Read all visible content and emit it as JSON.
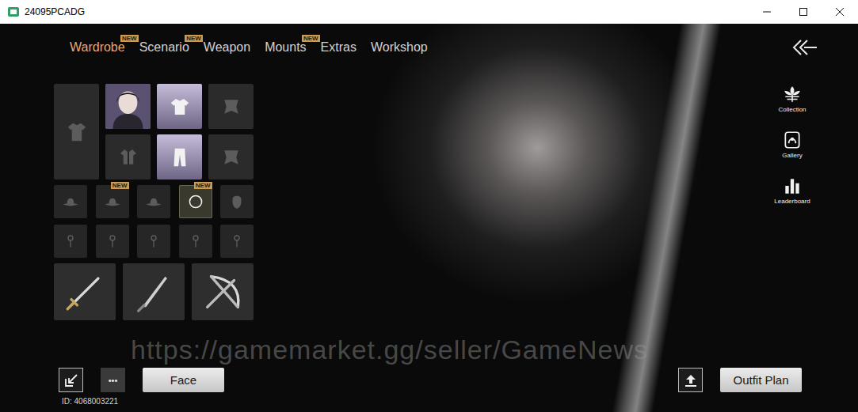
{
  "window": {
    "title": "24095PCADG"
  },
  "tabs": [
    {
      "label": "Wardrobe",
      "selected": true,
      "badge": "NEW"
    },
    {
      "label": "Scenario",
      "selected": false,
      "badge": "NEW"
    },
    {
      "label": "Weapon",
      "selected": false,
      "badge": ""
    },
    {
      "label": "Mounts",
      "selected": false,
      "badge": "NEW"
    },
    {
      "label": "Extras",
      "selected": false,
      "badge": ""
    },
    {
      "label": "Workshop",
      "selected": false,
      "badge": ""
    }
  ],
  "side_menu": [
    {
      "label": "Collection",
      "kind": "collection"
    },
    {
      "label": "Gallery",
      "kind": "gallery"
    },
    {
      "label": "Leaderboard",
      "kind": "leaderboard"
    }
  ],
  "outfit_slots": [
    {
      "kind": "robe",
      "filled": false
    },
    {
      "kind": "portrait",
      "filled": true
    },
    {
      "kind": "shirt",
      "filled": true
    },
    {
      "kind": "cape",
      "filled": false
    },
    {
      "kind": "jacket",
      "filled": false
    },
    {
      "kind": "pants",
      "filled": true
    },
    {
      "kind": "cape",
      "filled": false
    }
  ],
  "accessory_slots": [
    {
      "kind": "hat",
      "filled": false,
      "badge": ""
    },
    {
      "kind": "hat",
      "filled": false,
      "badge": "NEW"
    },
    {
      "kind": "hat",
      "filled": false,
      "badge": ""
    },
    {
      "kind": "ring",
      "filled": true,
      "badge": "NEW"
    },
    {
      "kind": "mask",
      "filled": false,
      "badge": ""
    }
  ],
  "jewelry_slots": [
    {
      "kind": "pin",
      "filled": false
    },
    {
      "kind": "pin",
      "filled": false
    },
    {
      "kind": "pin",
      "filled": false
    },
    {
      "kind": "pin",
      "filled": false
    },
    {
      "kind": "pin",
      "filled": false
    }
  ],
  "weapon_slots": [
    {
      "kind": "sword",
      "filled": true
    },
    {
      "kind": "blade",
      "filled": true
    },
    {
      "kind": "bow",
      "filled": true
    }
  ],
  "bottom_bar": {
    "more_button": "•••",
    "face_button": "Face",
    "player_id": "ID: 4068003221",
    "outfit_plan_button": "Outfit Plan"
  },
  "watermark": "https://gamemarket.gg/seller/GameNews"
}
